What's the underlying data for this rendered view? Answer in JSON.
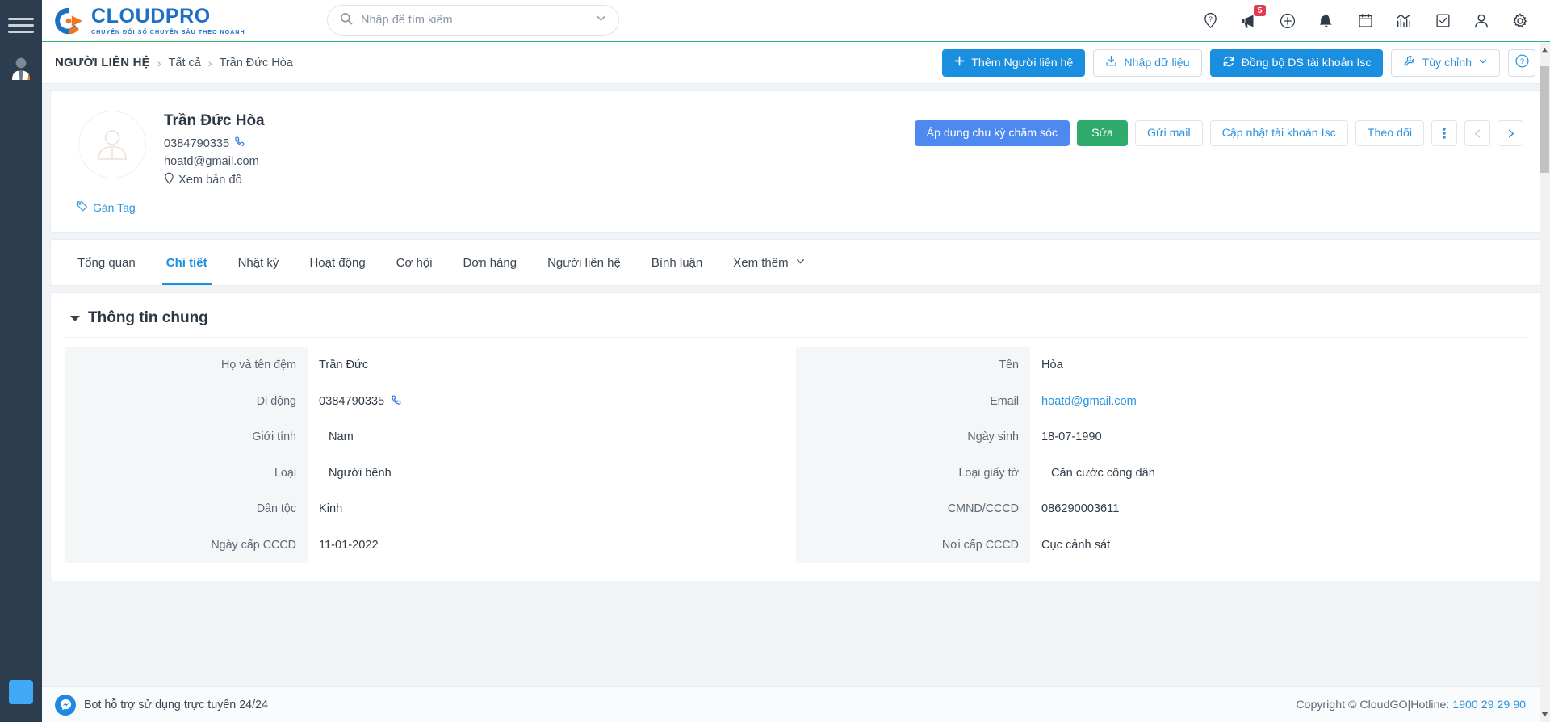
{
  "brand": {
    "name": "CLOUDPRO",
    "tagline": "CHUYỂN ĐỔI SỐ CHUYÊN SÂU THEO NGÀNH",
    "color": "#1f6fc4",
    "accent": "#ef7622"
  },
  "search": {
    "placeholder": "Nhập để tìm kiếm",
    "value": ""
  },
  "topbar": {
    "icons": [
      {
        "name": "help-location-icon",
        "glyph": "?"
      },
      {
        "name": "megaphone-icon",
        "badge": "5"
      },
      {
        "name": "plus-circle-icon"
      },
      {
        "name": "bell-icon"
      },
      {
        "name": "calendar-icon"
      },
      {
        "name": "analytics-icon"
      },
      {
        "name": "task-check-icon"
      },
      {
        "name": "user-icon"
      },
      {
        "name": "settings-gear-icon"
      }
    ]
  },
  "breadcrumb": {
    "root": "NGƯỜI LIÊN HỆ",
    "separator": "›",
    "items": [
      "Tất cả",
      "Trần Đức Hòa"
    ]
  },
  "crumb_actions": {
    "add": "Thêm Người liên hệ",
    "import": "Nhập dữ liệu",
    "sync": "Đồng bộ DS tài khoản Isc",
    "customize": "Tùy chỉnh",
    "help": "?"
  },
  "contact": {
    "name": "Trần Đức Hòa",
    "phone": "0384790335",
    "email": "hoatd@gmail.com",
    "map_link": "Xem bản đồ",
    "tag_link": "Gán Tag",
    "actions": {
      "care_cycle": "Áp dụng chu kỳ chăm sóc",
      "edit": "Sửa",
      "send_mail": "Gửi mail",
      "update_isc": "Cập nhật tài khoản Isc",
      "follow": "Theo dõi",
      "more": "⋮",
      "prev": "‹",
      "next": "›"
    }
  },
  "tabs": [
    {
      "label": "Tổng quan",
      "active": false
    },
    {
      "label": "Chi tiết",
      "active": true
    },
    {
      "label": "Nhật ký",
      "active": false
    },
    {
      "label": "Hoạt động",
      "active": false
    },
    {
      "label": "Cơ hội",
      "active": false
    },
    {
      "label": "Đơn hàng",
      "active": false
    },
    {
      "label": "Người liên hệ",
      "active": false
    },
    {
      "label": "Bình luận",
      "active": false
    },
    {
      "label": "Xem thêm",
      "active": false,
      "has_chevron": true
    }
  ],
  "panel": {
    "title": "Thông tin chung",
    "left_fields": [
      {
        "label": "Họ và tên đệm",
        "value": "Trần Đức",
        "type": "text"
      },
      {
        "label": "Di động",
        "value": "0384790335",
        "type": "phone"
      },
      {
        "label": "Giới tính",
        "value": "Nam",
        "type": "indent"
      },
      {
        "label": "Loại",
        "value": "Người bệnh",
        "type": "indent"
      },
      {
        "label": "Dân tộc",
        "value": "Kinh",
        "type": "text"
      },
      {
        "label": "Ngày cấp CCCD",
        "value": "11-01-2022",
        "type": "text"
      }
    ],
    "right_fields": [
      {
        "label": "Tên",
        "value": "Hòa",
        "type": "text"
      },
      {
        "label": "Email",
        "value": "hoatd@gmail.com",
        "type": "link"
      },
      {
        "label": "Ngày sinh",
        "value": "18-07-1990",
        "type": "text"
      },
      {
        "label": "Loại giấy tờ",
        "value": "Căn cước công dân",
        "type": "indent"
      },
      {
        "label": "CMND/CCCD",
        "value": "086290003611",
        "type": "text"
      },
      {
        "label": "Nơi cấp CCCD",
        "value": "Cục cảnh sát",
        "type": "text"
      }
    ]
  },
  "footer": {
    "bot_text": "Bot hỗ trợ sử dụng trực tuyến 24/24",
    "copyright": "Copyright © CloudGO",
    "divider": "|",
    "hotline_label": "Hotline:",
    "hotline": "1900 29 29 90"
  }
}
